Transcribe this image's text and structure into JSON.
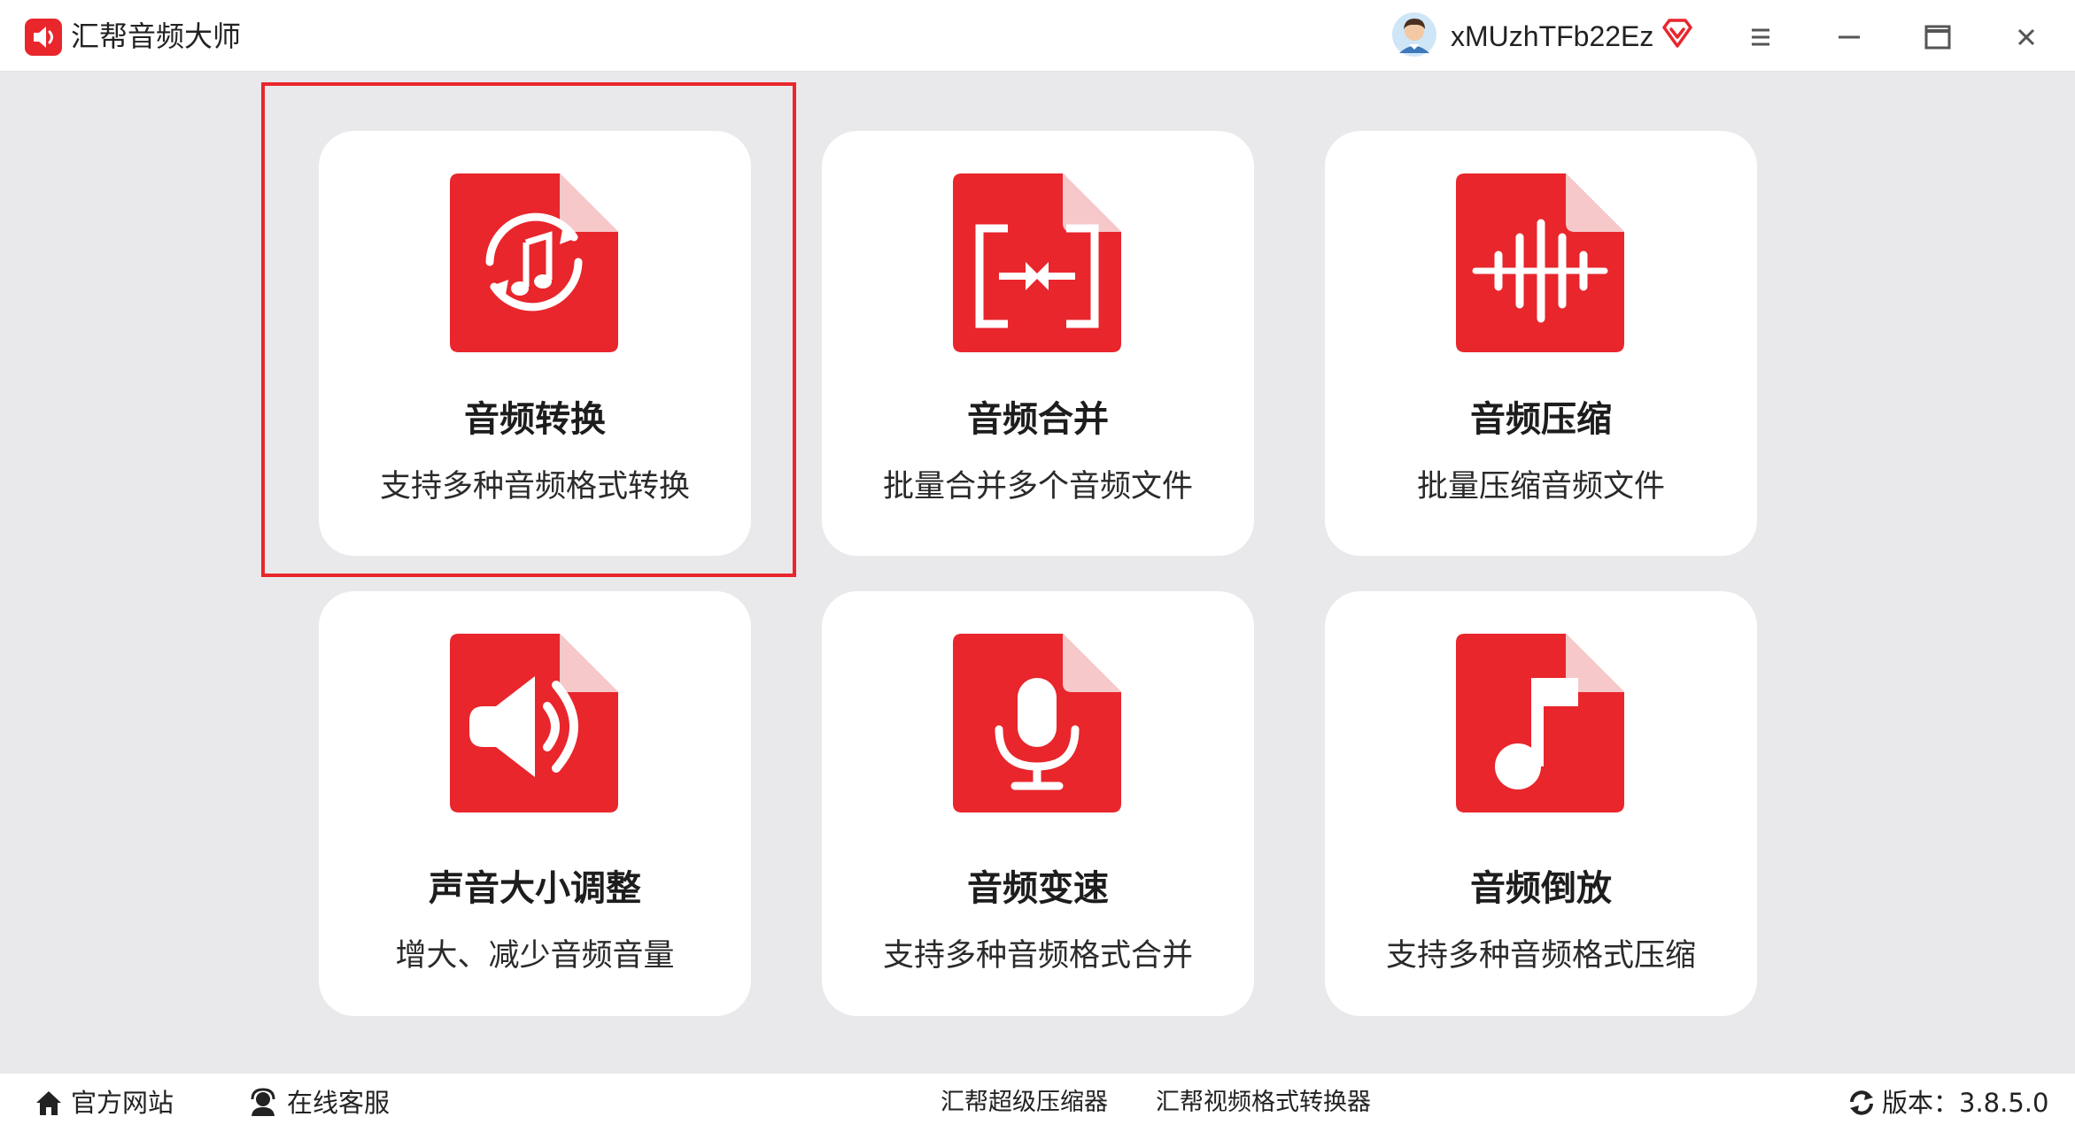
{
  "app": {
    "title": "汇帮音频大师",
    "logo_icon": "speaker-logo-icon",
    "brand_color": "#e8262c"
  },
  "header": {
    "username": "xMUzhTFb22Ez",
    "avatar_icon": "user-avatar-icon",
    "vip_icon": "vip-diamond-icon",
    "menu_icon": "hamburger-menu-icon",
    "minimize_icon": "minimize-icon",
    "maximize_icon": "maximize-icon",
    "close_icon": "close-icon"
  },
  "tools": [
    {
      "title": "音频转换",
      "desc": "支持多种音频格式转换",
      "icon": "audio-convert-icon",
      "selected": true
    },
    {
      "title": "音频合并",
      "desc": "批量合并多个音频文件",
      "icon": "audio-merge-icon"
    },
    {
      "title": "音频压缩",
      "desc": "批量压缩音频文件",
      "icon": "audio-compress-icon"
    },
    {
      "title": "声音大小调整",
      "desc": "增大、减少音频音量",
      "icon": "volume-adjust-icon"
    },
    {
      "title": "音频变速",
      "desc": "支持多种音频格式合并",
      "icon": "microphone-icon"
    },
    {
      "title": "音频倒放",
      "desc": "支持多种音频格式压缩",
      "icon": "music-note-icon"
    }
  ],
  "footer": {
    "website": "官方网站",
    "support": "在线客服",
    "link1": "汇帮超级压缩器",
    "link2": "汇帮视频格式转换器",
    "version": "版本：3.8.5.0"
  }
}
